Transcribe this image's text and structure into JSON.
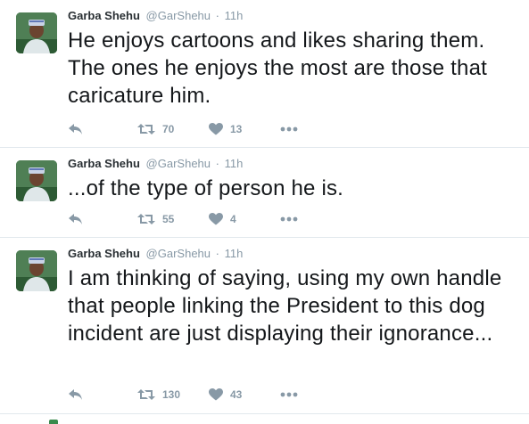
{
  "tweets": [
    {
      "author_name": "Garba Shehu",
      "author_handle": "@GarShehu",
      "separator": "·",
      "time": "11h",
      "text": "He enjoys cartoons and likes sharing them. The  ones he enjoys the most are those that caricature him.",
      "retweets": "70",
      "likes": "13"
    },
    {
      "author_name": "Garba Shehu",
      "author_handle": "@GarShehu",
      "separator": "·",
      "time": "11h",
      "text": "...of the type of person he is.",
      "retweets": "55",
      "likes": "4"
    },
    {
      "author_name": "Garba Shehu",
      "author_handle": "@GarShehu",
      "separator": "·",
      "time": "11h",
      "text": "I am thinking of saying, using my own handle that people linking the President to this dog incident are just displaying their ignorance...",
      "retweets": "130",
      "likes": "43"
    }
  ],
  "icons": {
    "reply": "reply-icon",
    "retweet": "retweet-icon",
    "like": "heart-icon",
    "more": "more-icon"
  },
  "colors": {
    "icon_gray": "#8899a6",
    "divider": "#e1e8ed",
    "text": "#14171a"
  }
}
